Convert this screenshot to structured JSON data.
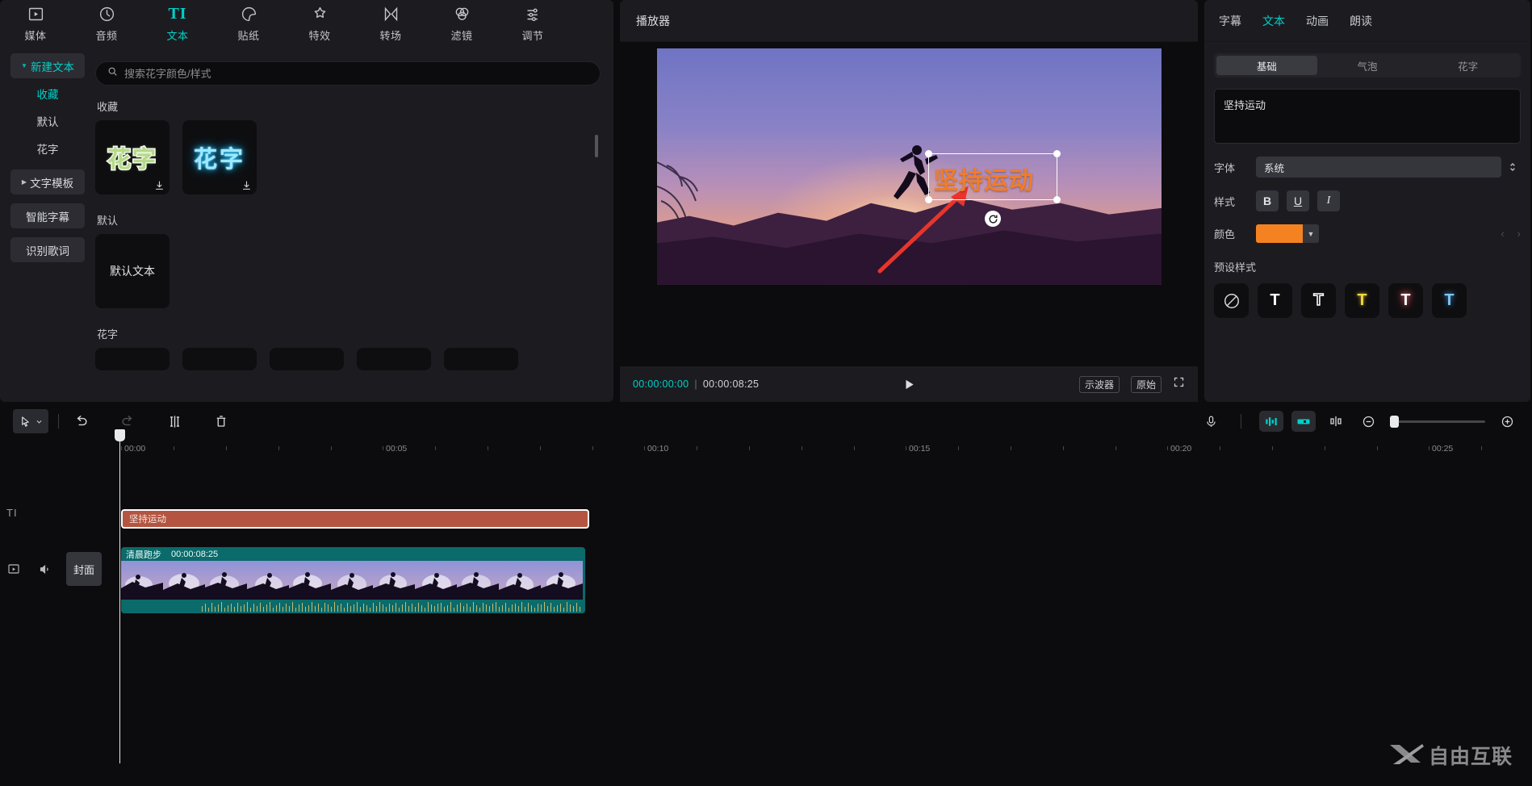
{
  "toolbar": {
    "tabs": [
      {
        "label": "媒体",
        "icon": "media-icon"
      },
      {
        "label": "音频",
        "icon": "audio-icon"
      },
      {
        "label": "文本",
        "icon": "text-icon"
      },
      {
        "label": "贴纸",
        "icon": "sticker-icon"
      },
      {
        "label": "特效",
        "icon": "effects-icon"
      },
      {
        "label": "转场",
        "icon": "transition-icon"
      },
      {
        "label": "滤镜",
        "icon": "filter-icon"
      },
      {
        "label": "调节",
        "icon": "adjust-icon"
      }
    ],
    "active": "文本"
  },
  "sidebar": {
    "items": [
      {
        "label": "新建文本",
        "type": "group-open"
      },
      {
        "label": "收藏",
        "type": "selected"
      },
      {
        "label": "默认",
        "type": "plain"
      },
      {
        "label": "花字",
        "type": "plain"
      },
      {
        "label": "文字模板",
        "type": "group-closed"
      },
      {
        "label": "智能字幕",
        "type": "group"
      },
      {
        "label": "识别歌词",
        "type": "group"
      }
    ]
  },
  "material": {
    "search_placeholder": "搜索花字颜色/样式",
    "search_value": "",
    "search_icon": "search-icon",
    "sections": [
      {
        "title": "收藏",
        "cards": [
          {
            "label": "花字",
            "style": "green-outline",
            "download_icon": "download-icon"
          },
          {
            "label": "花字",
            "style": "blue-neon",
            "download_icon": "download-icon"
          }
        ]
      },
      {
        "title": "默认",
        "cards": [
          {
            "label": "默认文本",
            "style": "plain"
          }
        ]
      },
      {
        "title": "花字",
        "cards": []
      }
    ]
  },
  "player": {
    "title": "播放器",
    "current_time": "00:00:00:00",
    "separator": "|",
    "total_time": "00:00:08:25",
    "play_icon": "play-icon",
    "scope_label": "示波器",
    "original_label": "原始",
    "fullscreen_icon": "fullscreen-icon",
    "overlay_text": "坚持运动",
    "overlay_color": "#f07c2c",
    "rotate_icon": "rotate-handle-icon"
  },
  "attributes": {
    "tabs": [
      {
        "label": "字幕"
      },
      {
        "label": "文本"
      },
      {
        "label": "动画"
      },
      {
        "label": "朗读"
      }
    ],
    "active_tab": "文本",
    "subtabs": [
      {
        "label": "基础"
      },
      {
        "label": "气泡"
      },
      {
        "label": "花字"
      }
    ],
    "active_subtab": "基础",
    "text_value": "坚持运动",
    "font_label": "字体",
    "font_value": "系统",
    "style_label": "样式",
    "style_buttons": [
      {
        "label": "B",
        "name": "bold"
      },
      {
        "label": "U",
        "name": "underline"
      },
      {
        "label": "I",
        "name": "italic"
      }
    ],
    "color_label": "颜色",
    "color_value": "#f58220",
    "preset_label": "预设样式",
    "presets": [
      {
        "name": "none",
        "glyph": "⃠",
        "color": "#d8d8dc"
      },
      {
        "name": "white-solid",
        "glyph": "T",
        "color": "#ffffff"
      },
      {
        "name": "outline",
        "glyph": "T",
        "color": "#0e0e10"
      },
      {
        "name": "yellow",
        "glyph": "T",
        "color": "#f5d73c"
      },
      {
        "name": "pink-glow",
        "glyph": "T",
        "color": "#f3a7a7"
      },
      {
        "name": "blue-glow",
        "glyph": "T",
        "color": "#7fc4f0"
      }
    ]
  },
  "timeline": {
    "tools": [
      {
        "name": "select-tool",
        "icon": "cursor-icon"
      },
      {
        "name": "undo",
        "icon": "undo-icon"
      },
      {
        "name": "redo",
        "icon": "redo-icon"
      },
      {
        "name": "split",
        "icon": "split-icon"
      },
      {
        "name": "delete",
        "icon": "trash-icon"
      }
    ],
    "right_tools": [
      {
        "name": "record",
        "icon": "mic-icon"
      },
      {
        "name": "mixer",
        "icon": "mixer-icon"
      },
      {
        "name": "adjustment",
        "icon": "adjustment-icon"
      },
      {
        "name": "link",
        "icon": "link-icon"
      },
      {
        "name": "zoom-out",
        "icon": "zoom-out-icon"
      },
      {
        "name": "zoom-slider",
        "icon": "slider-icon"
      },
      {
        "name": "zoom-in",
        "icon": "zoom-in-icon"
      }
    ],
    "ruler": [
      "00:00",
      "00:05",
      "00:10",
      "00:15",
      "00:20",
      "00:25"
    ],
    "track_label_text": "TI",
    "cover_button": "封面",
    "clips": {
      "text_clip": {
        "label": "坚持运动",
        "color": "#b35540"
      },
      "video_clip": {
        "label": "清晨跑步",
        "duration": "00:00:08:25",
        "color": "#0b6a6a"
      }
    }
  },
  "watermark": {
    "text": "自由互联",
    "logo": "x-logo-icon"
  }
}
